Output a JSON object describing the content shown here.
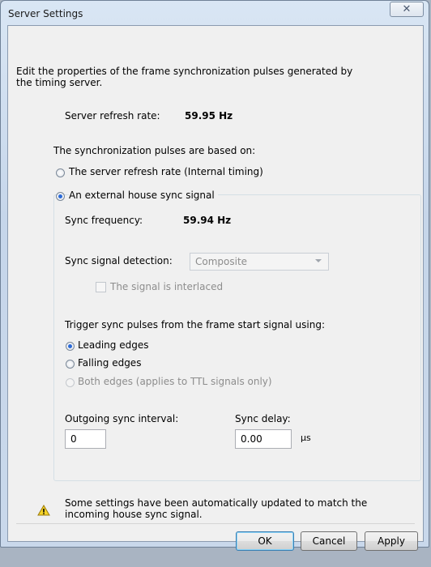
{
  "window": {
    "title": "Server Settings",
    "close_symbol": "✕"
  },
  "intro": "Edit the properties of the frame synchronization pulses generated by the timing server.",
  "server_refresh": {
    "label": "Server refresh rate:",
    "value": "59.95 Hz"
  },
  "pulses_based_on_label": "The synchronization pulses are based on:",
  "radio_internal": {
    "label": "The server refresh rate (Internal timing)",
    "checked": false
  },
  "radio_external": {
    "label": "An external house sync signal",
    "checked": true
  },
  "sync_frequency": {
    "label": "Sync frequency:",
    "value": "59.94 Hz"
  },
  "sync_detection": {
    "label": "Sync signal detection:",
    "selected": "Composite"
  },
  "interlaced": {
    "label": "The signal is interlaced",
    "checked": false
  },
  "trigger_label": "Trigger sync pulses from the frame start signal using:",
  "edges": [
    {
      "label": "Leading edges",
      "checked": true,
      "enabled": true
    },
    {
      "label": "Falling edges",
      "checked": false,
      "enabled": true
    },
    {
      "label": "Both edges (applies to TTL signals only)",
      "checked": false,
      "enabled": false
    }
  ],
  "outgoing_interval": {
    "label": "Outgoing sync interval:",
    "value": "0"
  },
  "sync_delay": {
    "label": "Sync delay:",
    "value": "0.00",
    "unit": "µs"
  },
  "warning": {
    "icon": "warning-icon",
    "line1": "Some settings have been automatically updated to match the",
    "line2": "incoming house sync signal."
  },
  "buttons": {
    "ok": "OK",
    "cancel": "Cancel",
    "apply": "Apply"
  },
  "colors": {
    "accent": "#2a6ad8",
    "warning_yellow": "#f5d327"
  }
}
